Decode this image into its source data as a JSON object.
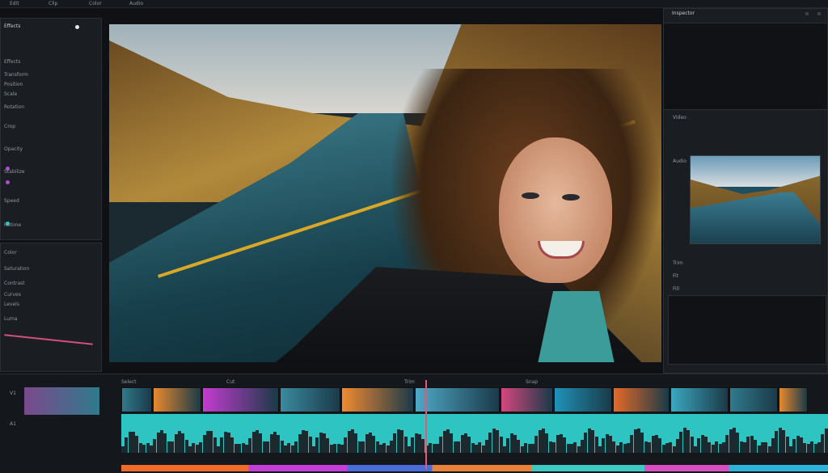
{
  "app": {
    "colors": {
      "accent": "#2ec4c2",
      "playhead": "#e25b74",
      "road": "#d9a826"
    }
  },
  "topbar": {
    "items": [
      "Edit",
      "Clip",
      "Color",
      "Audio"
    ],
    "title": "",
    "right": ""
  },
  "left_panel": {
    "header": "Effects",
    "items": [
      "Effects",
      "Transform",
      "Position",
      "Scale",
      "Rotation",
      "Crop",
      "Opacity",
      "Stabilize",
      "Speed",
      "Retime"
    ],
    "section2": [
      "Color",
      "Saturation",
      "Contrast",
      "Curves",
      "Levels",
      "Luma"
    ]
  },
  "right_panel": {
    "header": "Inspector",
    "tabs": [
      "Video",
      "Audio"
    ],
    "controls": [
      "Trim",
      "Fit",
      "Fill"
    ]
  },
  "timeline": {
    "tracks": [
      "V1",
      "A1"
    ],
    "tools": [
      "Select",
      "Cut",
      "Trim",
      "Snap"
    ],
    "clip_colors": [
      "#2f7a8c",
      "#e8892e",
      "#c23cd0",
      "#3c8aa0",
      "#f08a32",
      "#4fa8c9",
      "#d4477e",
      "#1f93b8",
      "#e46a28",
      "#3aa8c0"
    ]
  }
}
